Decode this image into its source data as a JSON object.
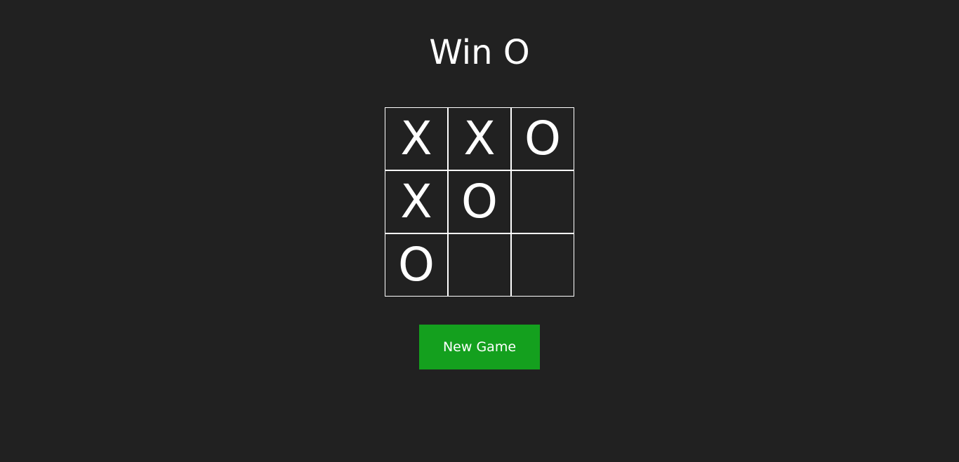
{
  "game": {
    "status_text": "Win O",
    "board": [
      [
        "X",
        "X",
        "O"
      ],
      [
        "X",
        "O",
        ""
      ],
      [
        "O",
        "",
        ""
      ]
    ],
    "new_game_label": "New Game"
  },
  "colors": {
    "background": "#212121",
    "grid_line": "#ffffff",
    "mark": "#ffffff",
    "button": "#14a01e"
  }
}
